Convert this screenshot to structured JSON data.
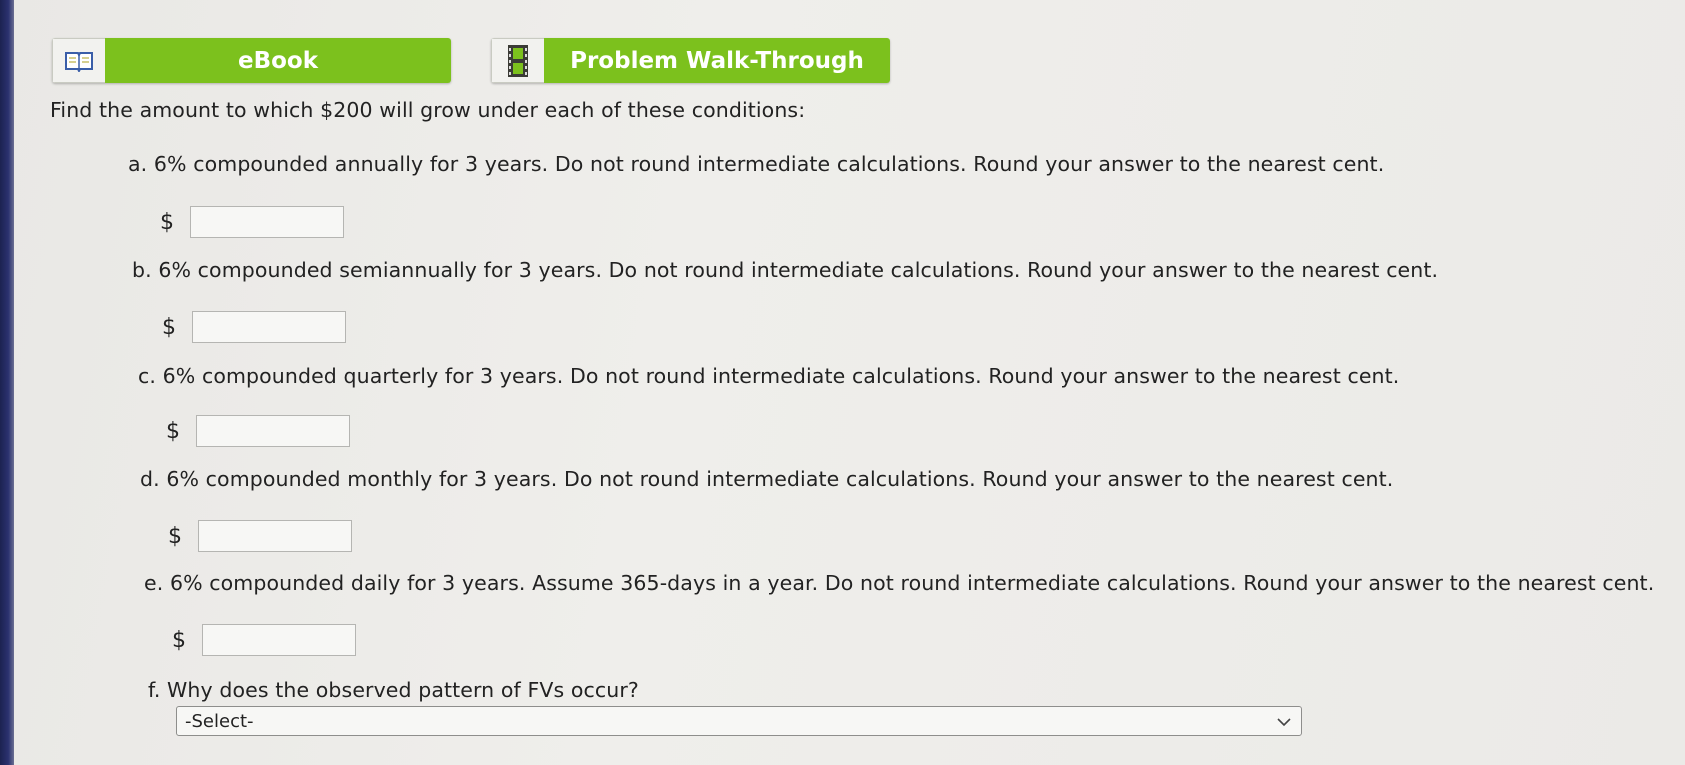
{
  "tabs": {
    "ebook_label": "eBook",
    "walkthrough_label": "Problem Walk-Through"
  },
  "question": {
    "intro": "Find the amount to which $200 will grow under each of these conditions:",
    "currency_symbol": "$",
    "parts": [
      {
        "text": "a. 6% compounded annually for 3 years. Do not round intermediate calculations. Round your answer to the nearest cent.",
        "value": ""
      },
      {
        "text": "b. 6% compounded semiannually for 3 years. Do not round intermediate calculations. Round your answer to the nearest cent.",
        "value": ""
      },
      {
        "text": "c. 6% compounded quarterly for 3 years. Do not round intermediate calculations. Round your answer to the nearest cent.",
        "value": ""
      },
      {
        "text": "d. 6% compounded monthly for 3 years. Do not round intermediate calculations. Round your answer to the nearest cent.",
        "value": ""
      },
      {
        "text": "e. 6% compounded daily for 3 years. Assume 365-days in a year. Do not round intermediate calculations. Round your answer to the nearest cent.",
        "value": ""
      },
      {
        "text": "f. Why does the observed pattern of FVs occur?"
      }
    ],
    "select_value": "-Select-"
  },
  "colors": {
    "tab_green": "#7cc11d",
    "text": "#222222"
  }
}
